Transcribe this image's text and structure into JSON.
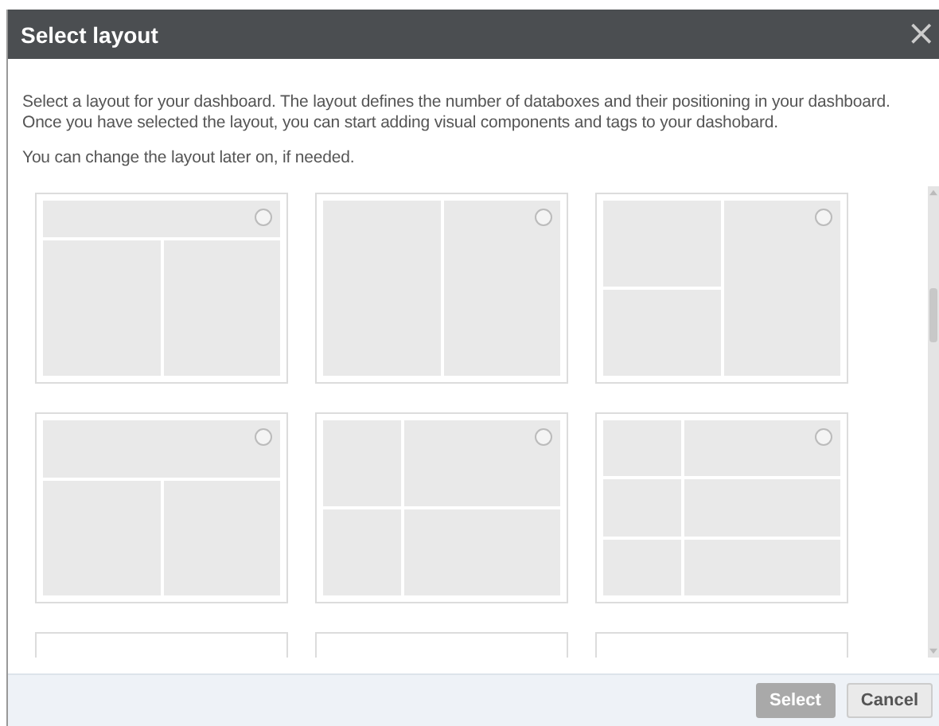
{
  "dialog": {
    "title": "Select layout",
    "close": "×"
  },
  "intro": [
    "Select a layout for your dashboard. The layout defines the number of databoxes and their positioning in your dashboard. Once you have selected the layout, you can start adding visual components and tags to your dashobard.",
    "You can change the layout later on, if needed."
  ],
  "layouts": [
    {
      "kind": "header-two-columns",
      "selected": false
    },
    {
      "kind": "two-columns",
      "selected": false
    },
    {
      "kind": "split-left-column",
      "selected": false
    },
    {
      "kind": "tall-header-two-columns",
      "selected": false
    },
    {
      "kind": "two-by-two",
      "selected": false
    },
    {
      "kind": "three-by-two",
      "selected": false
    },
    {
      "kind": "clipped"
    },
    {
      "kind": "clipped"
    },
    {
      "kind": "clipped"
    }
  ],
  "buttons": [
    {
      "label": "Select",
      "disabled": true
    },
    {
      "label": "Cancel",
      "disabled": false
    }
  ]
}
